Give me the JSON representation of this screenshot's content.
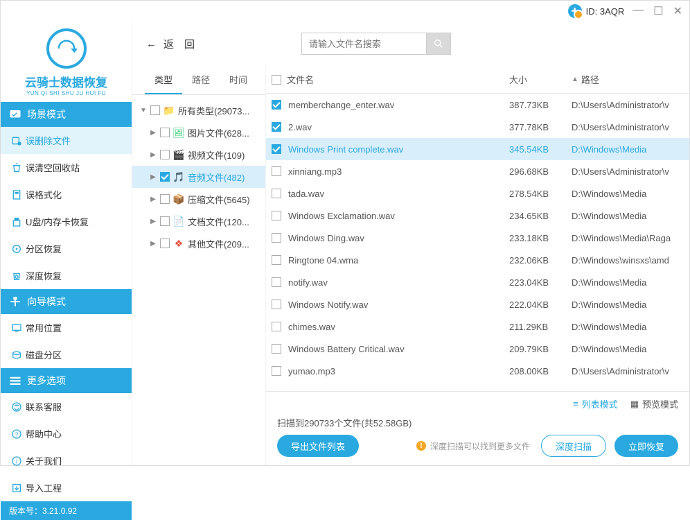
{
  "titlebar": {
    "id_label": "ID: 3AQR"
  },
  "logo": {
    "title": "云骑士数据恢复",
    "sub": "YUN QI SHI SHU JU HUI FU"
  },
  "sidebar": {
    "section1": {
      "header": "场景模式",
      "items": [
        {
          "label": "误删除文件",
          "selected": true
        },
        {
          "label": "误清空回收站"
        },
        {
          "label": "误格式化"
        },
        {
          "label": "U盘/内存卡恢复"
        },
        {
          "label": "分区恢复"
        },
        {
          "label": "深度恢复"
        }
      ]
    },
    "section2": {
      "header": "向导模式",
      "items": [
        {
          "label": "常用位置"
        },
        {
          "label": "磁盘分区"
        }
      ]
    },
    "section3": {
      "header": "更多选项",
      "items": [
        {
          "label": "联系客服"
        },
        {
          "label": "帮助中心"
        },
        {
          "label": "关于我们"
        },
        {
          "label": "导入工程"
        }
      ]
    }
  },
  "version": "版本号：3.21.0.92",
  "toolbar": {
    "back": "返　回",
    "search_placeholder": "请输入文件名搜索"
  },
  "tree": {
    "tabs": [
      {
        "label": "类型",
        "active": true
      },
      {
        "label": "路径"
      },
      {
        "label": "时间"
      }
    ],
    "rows": [
      {
        "expand": "▼",
        "label": "所有类型(29073...",
        "icon": "folder",
        "color": "#f7b733"
      },
      {
        "expand": "▶",
        "label": "图片文件(628...",
        "icon": "image",
        "color": "#2ecc71"
      },
      {
        "expand": "▶",
        "label": "视频文件(109)",
        "icon": "video",
        "color": "#16a085"
      },
      {
        "expand": "▶",
        "label": "音频文件(482)",
        "icon": "audio",
        "color": "#b455d6",
        "selected": true,
        "checked": true
      },
      {
        "expand": "▶",
        "label": "压缩文件(5645)",
        "icon": "archive",
        "color": "#f39c12"
      },
      {
        "expand": "▶",
        "label": "文档文件(120...",
        "icon": "doc",
        "color": "#2b5797"
      },
      {
        "expand": "▶",
        "label": "其他文件(209...",
        "icon": "other",
        "color": "#e74c3c"
      }
    ]
  },
  "filelist": {
    "headers": {
      "name": "文件名",
      "size": "大小",
      "path": "路径"
    },
    "rows": [
      {
        "name": "memberchange_enter.wav",
        "size": "387.73KB",
        "path": "D:\\Users\\Administrator\\v",
        "checked": true
      },
      {
        "name": "2.wav",
        "size": "377.78KB",
        "path": "D:\\Users\\Administrator\\v",
        "checked": true
      },
      {
        "name": "Windows Print complete.wav",
        "size": "345.54KB",
        "path": "D:\\Windows\\Media",
        "checked": true,
        "selected": true
      },
      {
        "name": "xinniang.mp3",
        "size": "296.68KB",
        "path": "D:\\Users\\Administrator\\v"
      },
      {
        "name": "tada.wav",
        "size": "278.54KB",
        "path": "D:\\Windows\\Media"
      },
      {
        "name": "Windows Exclamation.wav",
        "size": "234.65KB",
        "path": "D:\\Windows\\Media"
      },
      {
        "name": "Windows Ding.wav",
        "size": "233.18KB",
        "path": "D:\\Windows\\Media\\Raga"
      },
      {
        "name": "Ringtone 04.wma",
        "size": "232.06KB",
        "path": "D:\\Windows\\winsxs\\amd"
      },
      {
        "name": "notify.wav",
        "size": "223.04KB",
        "path": "D:\\Windows\\Media"
      },
      {
        "name": "Windows Notify.wav",
        "size": "222.04KB",
        "path": "D:\\Windows\\Media"
      },
      {
        "name": "chimes.wav",
        "size": "211.29KB",
        "path": "D:\\Windows\\Media"
      },
      {
        "name": "Windows Battery Critical.wav",
        "size": "209.79KB",
        "path": "D:\\Windows\\Media"
      },
      {
        "name": "yumao.mp3",
        "size": "208.00KB",
        "path": "D:\\Users\\Administrator\\v"
      }
    ]
  },
  "footer": {
    "view_list": "列表模式",
    "view_preview": "预览模式",
    "scan_info": "扫描到290733个文件(共52.58GB)",
    "export": "导出文件列表",
    "hint": "深度扫描可以找到更多文件",
    "deep_scan": "深度扫描",
    "recover": "立即恢复"
  }
}
